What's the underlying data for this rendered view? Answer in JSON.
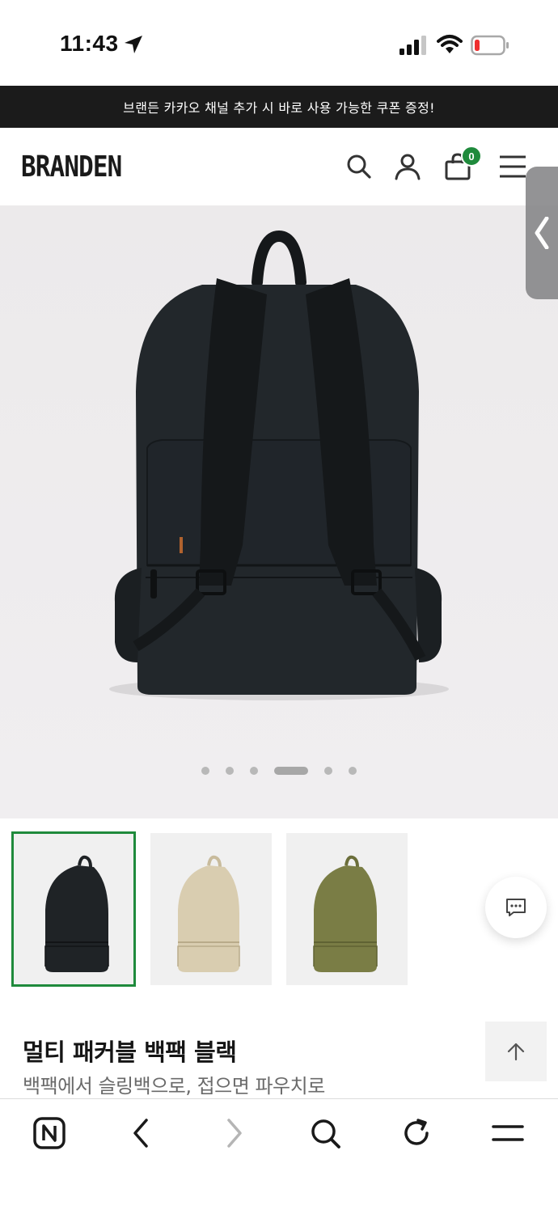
{
  "status_bar": {
    "time": "11:43"
  },
  "promo": {
    "text": "브랜든 카카오 채널 추가 시 바로 사용 가능한 쿠폰 증정!"
  },
  "header": {
    "logo": "BRANDEN",
    "cart_count": "0"
  },
  "carousel": {
    "slide_count": 6,
    "active_index": 3
  },
  "thumbnails": [
    {
      "color": "black",
      "hex": "#1f2326",
      "selected": true
    },
    {
      "color": "beige",
      "hex": "#d9cdb0",
      "selected": false
    },
    {
      "color": "olive",
      "hex": "#7a7d45",
      "selected": false
    }
  ],
  "product": {
    "title": "멀티 패커블 백팩 블랙",
    "subtitle": "백팩에서 슬링백으로, 접으면 파우치로"
  },
  "colors": {
    "accent": "#1f8a3c",
    "promo_bg": "#1b1b1b"
  },
  "browser_bar": {
    "icons": [
      "naver-home-icon",
      "back-icon",
      "forward-icon",
      "search-icon",
      "reload-icon",
      "menu-icon"
    ]
  }
}
